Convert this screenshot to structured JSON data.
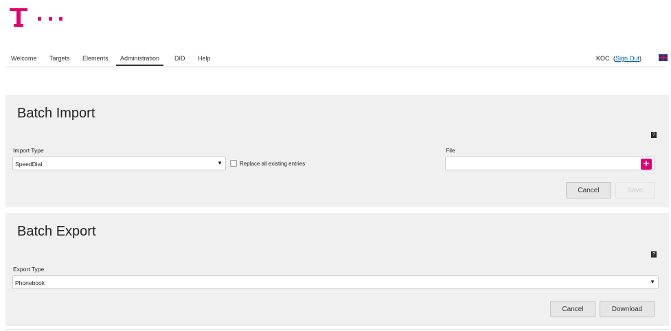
{
  "brand": {
    "color": "#e20074",
    "logo_icon": "telekom-t-logo"
  },
  "nav": {
    "items": [
      "Welcome",
      "Targets",
      "Elements",
      "Administration",
      "DID",
      "Help"
    ],
    "active": "Administration",
    "user": "KOC",
    "signout_open": "(",
    "signout_label": "Sign Out",
    "signout_close": ")",
    "language_icon": "uk-flag-icon"
  },
  "import_panel": {
    "title": "Batch Import",
    "help_icon": "?",
    "import_type_label": "Import Type",
    "import_type_value": "SpeedDial",
    "replace_label": "Replace all existing entries",
    "replace_checked": false,
    "file_label": "File",
    "file_value": "",
    "add_file_icon": "+",
    "cancel_label": "Cancel",
    "save_label": "Save"
  },
  "export_panel": {
    "title": "Batch Export",
    "help_icon": "?",
    "export_type_label": "Export Type",
    "export_type_value": "Phonebook",
    "cancel_label": "Cancel",
    "download_label": "Download"
  }
}
